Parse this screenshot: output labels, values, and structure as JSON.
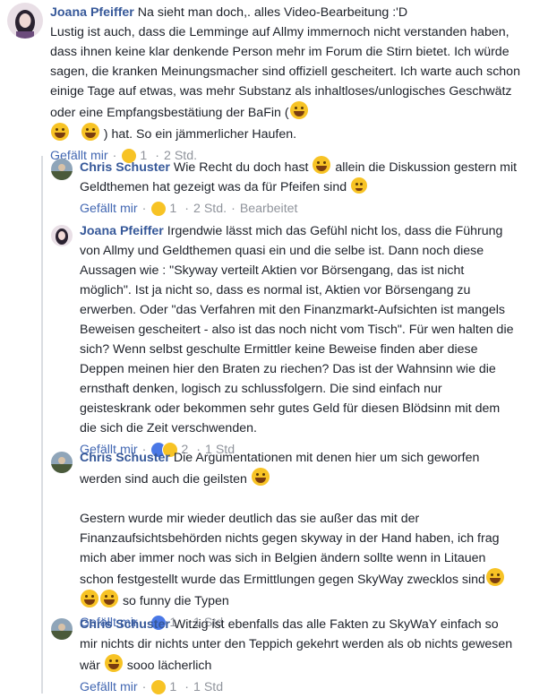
{
  "comments": [
    {
      "author": "Joana Pfeiffer",
      "text_first": "Na sieht man doch,. alles Video-Bearbeitung :'D",
      "text_rest": "Lustig ist auch, dass die Lemminge auf Allmy immernoch nicht verstanden haben, dass ihnen keine klar denkende Person mehr im Forum die Stirn bietet. Ich würde sagen, die kranken Meinungsmacher sind offiziell gescheitert. Ich warte auch schon einige Tage auf etwas, was mehr Substanz als inhaltloses/unlogisches Geschwätz oder eine Empfangsbestätiung der BaFin (",
      "text_tail": ") hat. So ein jämmerlicher Haufen.",
      "like": "Gefällt mir",
      "reactions": "1",
      "time": "2 Std."
    },
    {
      "author": "Chris Schuster",
      "text": "Wie Recht du doch hast",
      "text2": "allein die Diskussion gestern mit Geldthemen hat gezeigt was da für Pfeifen sind",
      "like": "Gefällt mir",
      "reactions": "1",
      "time": "2 Std.",
      "edited": "Bearbeitet"
    },
    {
      "author": "Joana Pfeiffer",
      "text": "Irgendwie lässt mich das Gefühl nicht los, dass die Führung von Allmy und Geldthemen quasi ein und die selbe ist. Dann noch diese Aussagen wie : \"Skyway verteilt Aktien vor Börsengang, das ist nicht möglich\". Ist ja nicht so, dass es normal ist, Aktien vor Börsengang zu erwerben. Oder \"das Verfahren mit den Finanzmarkt-Aufsichten ist mangels Beweisen gescheitert - also ist das noch nicht vom Tisch\". Für wen halten die sich? Wenn selbst geschulte Ermittler keine Beweise finden aber diese Deppen meinen hier den Braten zu riechen? Das ist der Wahnsinn wie die ernsthaft denken, logisch zu schlussfolgern. Die sind einfach nur geisteskrank oder bekommen sehr gutes Geld für diesen Blödsinn mit dem die sich die Zeit verschwenden.",
      "like": "Gefällt mir",
      "reactions": "2",
      "time": "1 Std"
    },
    {
      "author": "Chris Schuster",
      "text": "Die Argumentationen mit denen hier um sich geworfen werden sind auch die geilsten",
      "text_p2": "Gestern wurde mir wieder deutlich das sie außer das mit der Finanzaufsichtsbehörden nichts gegen skyway in der Hand haben, ich frag mich aber immer noch was sich in Belgien ändern sollte wenn in Litauen schon festgestellt wurde das Ermittlungen gegen SkyWay zwecklos sind",
      "text_p2_tail": "so funny die Typen",
      "like": "Gefällt mir",
      "reactions": "1",
      "time": "1 Std"
    },
    {
      "author": "Chris Schuster",
      "text": "Witzig ist ebenfalls das alle Fakten zu SkyWaY einfach so mir nichts dir nichts unter den Teppich gekehrt werden als ob nichts gewesen wär",
      "text_tail": "sooo lächerlich",
      "like": "Gefällt mir",
      "reactions": "1",
      "time": "1 Std"
    }
  ],
  "colors": {
    "link": "#365899",
    "meta": "#90949c",
    "text": "#1d2129"
  },
  "icons": [
    "avatar-joana",
    "avatar-chris",
    "laughing-emoji",
    "wink-emoji",
    "like-reaction-icon",
    "haha-reaction-icon"
  ]
}
